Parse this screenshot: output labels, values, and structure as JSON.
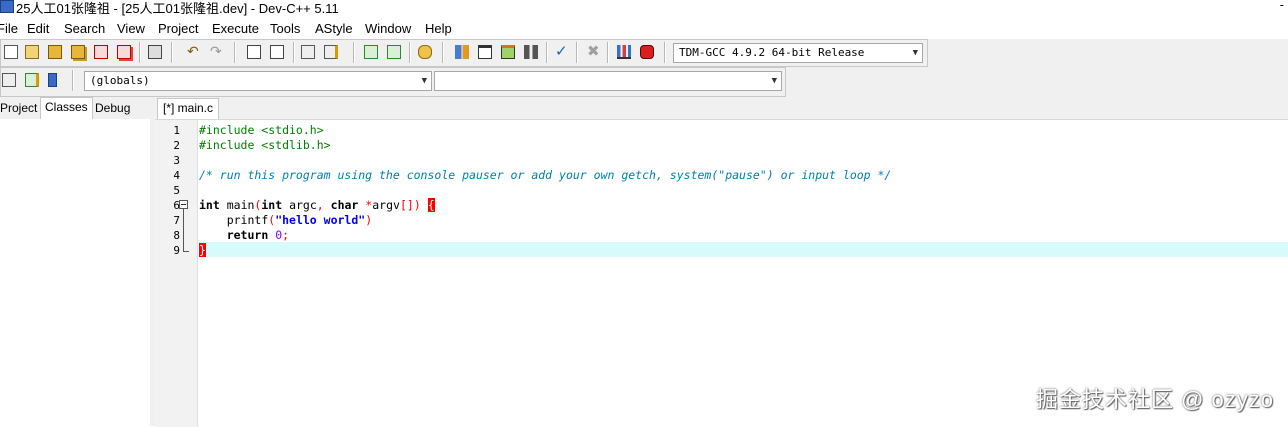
{
  "window": {
    "title": "25人工01张隆祖 - [25人工01张隆祖.dev] - Dev-C++ 5.11",
    "minimize_glyph": "-"
  },
  "menu": [
    "File",
    "Edit",
    "Search",
    "View",
    "Project",
    "Execute",
    "Tools",
    "AStyle",
    "Window",
    "Help"
  ],
  "toolbar": {
    "compiler_select": "TDM-GCC 4.9.2 64-bit Release",
    "scope_select": "(globals)",
    "symbol_select": ""
  },
  "left_tabs": [
    "Project",
    "Classes",
    "Debug"
  ],
  "left_active_tab": "Classes",
  "editor": {
    "tab_label": "[*] main.c",
    "current_line": 9,
    "line_numbers": [
      "1",
      "2",
      "3",
      "4",
      "5",
      "6",
      "7",
      "8",
      "9"
    ],
    "lines": [
      "#include <stdio.h>",
      "#include <stdlib.h>",
      "",
      "/* run this program using the console pauser or add your own getch, system(\"pause\") or input loop */",
      "",
      "int main(int argc, char *argv[]) {",
      "    printf(\"hello world\")",
      "    return 0;",
      "}"
    ]
  },
  "watermark": "掘金技术社区 @ ozyzo",
  "colors": {
    "preprocessor": "#008000",
    "comment": "#007fb2",
    "string": "#0000ff",
    "number": "#8000ff",
    "brace_highlight": "#ff0000",
    "current_line": "#d7fbfb"
  }
}
